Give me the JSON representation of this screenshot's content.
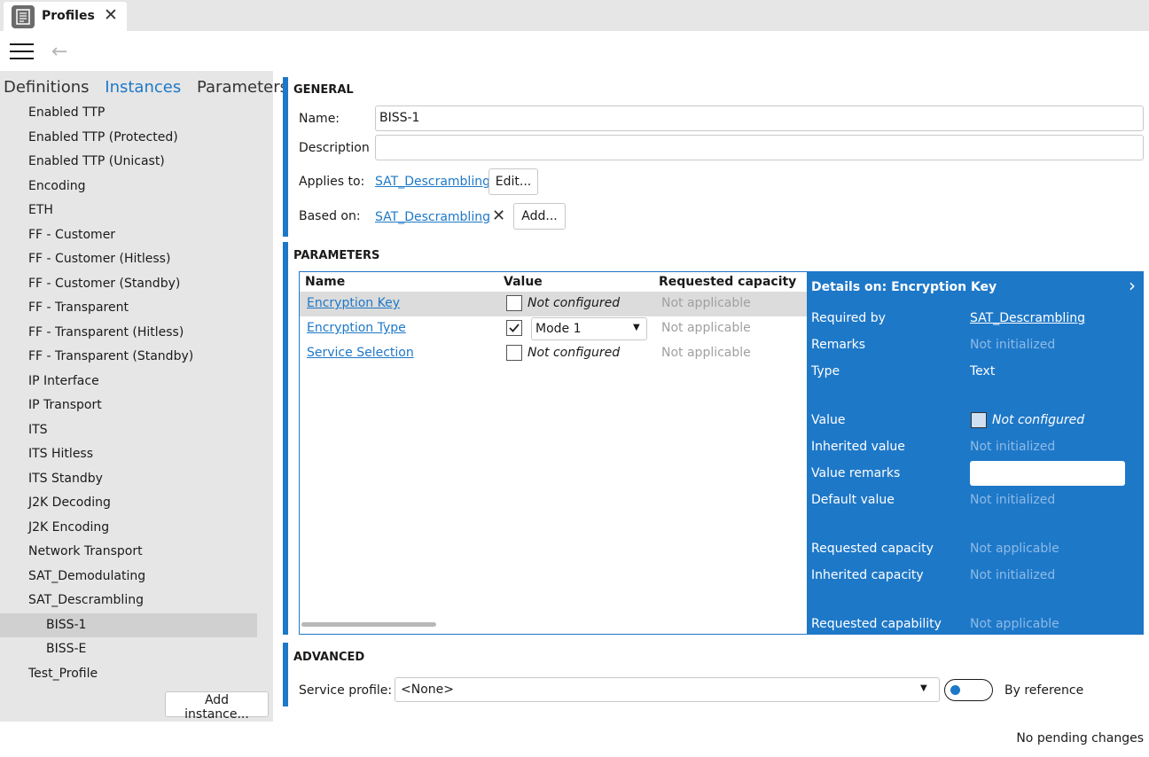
{
  "tab": {
    "title": "Profiles",
    "icon": "document-icon",
    "close": "✕"
  },
  "toolbar": {
    "menu_icon": "hamburger-icon",
    "back_icon": "←"
  },
  "left": {
    "tabs": [
      "Definitions",
      "Instances",
      "Parameters"
    ],
    "active_tab": "Instances",
    "items": [
      {
        "label": "Enabled TTP",
        "child": false
      },
      {
        "label": "Enabled TTP (Protected)",
        "child": false
      },
      {
        "label": "Enabled TTP (Unicast)",
        "child": false
      },
      {
        "label": "Encoding",
        "child": false
      },
      {
        "label": "ETH",
        "child": false
      },
      {
        "label": "FF - Customer",
        "child": false
      },
      {
        "label": "FF - Customer (Hitless)",
        "child": false
      },
      {
        "label": "FF - Customer (Standby)",
        "child": false
      },
      {
        "label": "FF - Transparent",
        "child": false
      },
      {
        "label": "FF - Transparent (Hitless)",
        "child": false
      },
      {
        "label": "FF - Transparent (Standby)",
        "child": false
      },
      {
        "label": "IP Interface",
        "child": false
      },
      {
        "label": "IP Transport",
        "child": false
      },
      {
        "label": "ITS",
        "child": false
      },
      {
        "label": "ITS Hitless",
        "child": false
      },
      {
        "label": "ITS Standby",
        "child": false
      },
      {
        "label": "J2K Decoding",
        "child": false
      },
      {
        "label": "J2K Encoding",
        "child": false
      },
      {
        "label": "Network Transport",
        "child": false
      },
      {
        "label": "SAT_Demodulating",
        "child": false
      },
      {
        "label": "SAT_Descrambling",
        "child": false
      },
      {
        "label": "BISS-1",
        "child": true,
        "selected": true
      },
      {
        "label": "BISS-E",
        "child": true
      },
      {
        "label": "Test_Profile",
        "child": false
      }
    ],
    "add_button": "Add instance..."
  },
  "general": {
    "heading": "GENERAL",
    "name_label": "Name:",
    "name_value": "BISS-1",
    "description_label": "Description",
    "description_value": "",
    "applies_label": "Applies to:",
    "applies_link": "SAT_Descrambling",
    "edit_button": "Edit...",
    "based_label": "Based on:",
    "based_link": "SAT_Descrambling",
    "remove_icon": "✕",
    "add_button": "Add..."
  },
  "parameters": {
    "heading": "PARAMETERS",
    "columns": [
      "Name",
      "Value",
      "Requested capacity"
    ],
    "rows": [
      {
        "name": "Encryption Key",
        "checked": false,
        "value": "Not configured",
        "capacity": "Not applicable",
        "selected": true
      },
      {
        "name": "Encryption Type",
        "checked": true,
        "value": "Mode 1",
        "capacity": "Not applicable",
        "dropdown": true
      },
      {
        "name": "Service Selection",
        "checked": false,
        "value": "Not configured",
        "capacity": "Not applicable"
      }
    ]
  },
  "details": {
    "title": "Details on: Encryption Key",
    "expand_icon": "›",
    "required_by_label": "Required by",
    "required_by_value": "SAT_Descrambling",
    "remarks_label": "Remarks",
    "remarks_value": "Not initialized",
    "type_label": "Type",
    "type_value": "Text",
    "value_label": "Value",
    "value_value": "Not configured",
    "inherited_value_label": "Inherited value",
    "inherited_value_value": "Not initialized",
    "value_remarks_label": "Value remarks",
    "default_value_label": "Default value",
    "default_value_value": "Not initialized",
    "requested_capacity_label": "Requested capacity",
    "requested_capacity_value": "Not applicable",
    "inherited_capacity_label": "Inherited capacity",
    "inherited_capacity_value": "Not initialized",
    "requested_capability_label": "Requested capability",
    "requested_capability_value": "Not applicable"
  },
  "advanced": {
    "heading": "ADVANCED",
    "service_label": "Service profile:",
    "service_value": "<None>",
    "toggle_label": "By reference"
  },
  "status": "No pending changes",
  "colors": {
    "accent": "#1e78c8",
    "panel": "#e6e6e6"
  }
}
